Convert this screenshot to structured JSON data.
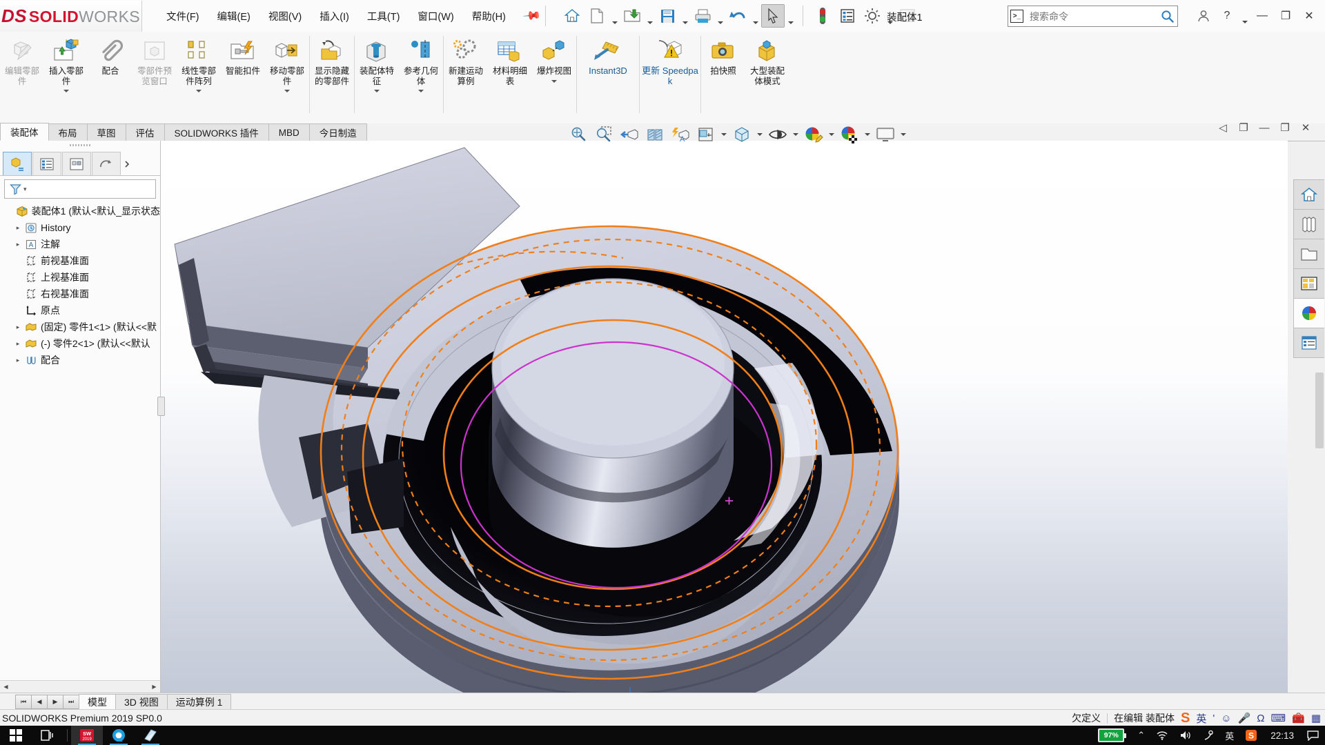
{
  "app": {
    "brand_ds": "DS",
    "brand_solid": "SOLID",
    "brand_works": "WORKS",
    "document_title": "装配体1",
    "version_text": "SOLIDWORKS Premium 2019 SP0.0"
  },
  "menu": {
    "items": [
      {
        "label": "文件(F)",
        "name": "menu-file"
      },
      {
        "label": "编辑(E)",
        "name": "menu-edit"
      },
      {
        "label": "视图(V)",
        "name": "menu-view"
      },
      {
        "label": "插入(I)",
        "name": "menu-insert"
      },
      {
        "label": "工具(T)",
        "name": "menu-tools"
      },
      {
        "label": "窗口(W)",
        "name": "menu-window"
      },
      {
        "label": "帮助(H)",
        "name": "menu-help"
      }
    ]
  },
  "quick_access": {
    "icons": [
      "home-icon",
      "new-document-icon",
      "open-folder-icon",
      "save-icon",
      "print-icon",
      "undo-icon",
      "select-cursor-icon",
      "rebuild-traffic-light-icon",
      "options-list-icon",
      "gear-settings-icon",
      "image-icon"
    ]
  },
  "search": {
    "placeholder": "搜索命令",
    "value": "",
    "icon": "command-search-icon"
  },
  "window_buttons": {
    "user": "user-account-icon",
    "help": "help-icon",
    "minimize": "—",
    "maximize": "❐",
    "close": "✕"
  },
  "ribbon": {
    "groups": [
      {
        "items": [
          {
            "label": "编辑零部件",
            "icon": "edit-component-icon",
            "disabled": true,
            "name": "ribbon-edit-component"
          },
          {
            "label": "插入零部件",
            "icon": "insert-component-icon",
            "disabled": false,
            "caret": true,
            "name": "ribbon-insert-component"
          },
          {
            "label": "配合",
            "icon": "mate-paperclip-icon",
            "disabled": false,
            "name": "ribbon-mate"
          },
          {
            "label": "零部件预览窗口",
            "icon": "component-preview-icon",
            "disabled": true,
            "name": "ribbon-component-preview"
          },
          {
            "label": "线性零部件阵列",
            "icon": "linear-pattern-icon",
            "disabled": false,
            "caret": true,
            "name": "ribbon-linear-pattern"
          },
          {
            "label": "智能扣件",
            "icon": "smart-fasteners-icon",
            "disabled": false,
            "name": "ribbon-smart-fasteners"
          },
          {
            "label": "移动零部件",
            "icon": "move-component-icon",
            "disabled": false,
            "caret": true,
            "name": "ribbon-move-component"
          }
        ]
      },
      {
        "items": [
          {
            "label": "显示隐藏的零部件",
            "icon": "show-hidden-components-icon",
            "disabled": false,
            "name": "ribbon-show-hidden"
          }
        ]
      },
      {
        "items": [
          {
            "label": "装配体特征",
            "icon": "assembly-feature-icon",
            "disabled": false,
            "caret": true,
            "name": "ribbon-assembly-feature"
          },
          {
            "label": "参考几何体",
            "icon": "reference-geometry-icon",
            "disabled": false,
            "caret": true,
            "name": "ribbon-reference-geometry"
          }
        ]
      },
      {
        "items": [
          {
            "label": "新建运动算例",
            "icon": "new-motion-study-icon",
            "disabled": false,
            "name": "ribbon-new-motion-study"
          },
          {
            "label": "材料明细表",
            "icon": "bill-of-materials-icon",
            "disabled": false,
            "name": "ribbon-bom"
          },
          {
            "label": "爆炸视图",
            "icon": "exploded-view-icon",
            "disabled": false,
            "caret": true,
            "name": "ribbon-exploded-view"
          }
        ]
      },
      {
        "items": [
          {
            "label": "Instant3D",
            "icon": "instant3d-ruler-icon",
            "disabled": false,
            "blue": true,
            "name": "ribbon-instant3d"
          }
        ]
      },
      {
        "items": [
          {
            "label": "更新 Speedpak",
            "icon": "update-speedpak-icon",
            "disabled": false,
            "blue": true,
            "name": "ribbon-update-speedpak"
          }
        ]
      },
      {
        "items": [
          {
            "label": "拍快照",
            "icon": "take-snapshot-camera-icon",
            "disabled": false,
            "name": "ribbon-take-snapshot"
          },
          {
            "label": "大型装配体模式",
            "icon": "large-assembly-mode-icon",
            "disabled": false,
            "name": "ribbon-large-assembly-mode"
          }
        ]
      }
    ]
  },
  "command_tabs": {
    "selected": "装配体",
    "items": [
      "装配体",
      "布局",
      "草图",
      "评估",
      "SOLIDWORKS 插件",
      "MBD",
      "今日制造"
    ]
  },
  "left_panel": {
    "tabs": [
      {
        "name": "feature-manager-tab",
        "icon": "feature-tree-icon",
        "selected": true
      },
      {
        "name": "property-manager-tab",
        "icon": "property-list-icon",
        "selected": false
      },
      {
        "name": "configuration-manager-tab",
        "icon": "configuration-icon",
        "selected": false
      },
      {
        "name": "dimxpert-manager-tab",
        "icon": "dimxpert-icon",
        "selected": false
      }
    ],
    "filter_placeholder": "",
    "filter_icon": "filter-funnel-icon",
    "tree": [
      {
        "label": "装配体1  (默认<默认_显示状态",
        "icon": "assembly-icon",
        "indent": 0,
        "expandable": false,
        "name": "tree-root-assembly"
      },
      {
        "label": "History",
        "icon": "history-icon",
        "indent": 1,
        "expandable": true,
        "name": "tree-history"
      },
      {
        "label": "注解",
        "icon": "annotations-icon",
        "indent": 1,
        "expandable": true,
        "name": "tree-annotations"
      },
      {
        "label": "前视基准面",
        "icon": "plane-icon",
        "indent": 1,
        "expandable": false,
        "name": "tree-front-plane"
      },
      {
        "label": "上视基准面",
        "icon": "plane-icon",
        "indent": 1,
        "expandable": false,
        "name": "tree-top-plane"
      },
      {
        "label": "右视基准面",
        "icon": "plane-icon",
        "indent": 1,
        "expandable": false,
        "name": "tree-right-plane"
      },
      {
        "label": "原点",
        "icon": "origin-icon",
        "indent": 1,
        "expandable": false,
        "name": "tree-origin"
      },
      {
        "label": "(固定) 零件1<1>  (默认<<默",
        "icon": "part-icon",
        "indent": 1,
        "expandable": true,
        "name": "tree-part1"
      },
      {
        "label": "(-) 零件2<1>  (默认<<默认",
        "icon": "part-icon",
        "indent": 1,
        "expandable": true,
        "name": "tree-part2"
      },
      {
        "label": "配合",
        "icon": "mates-icon",
        "indent": 1,
        "expandable": true,
        "name": "tree-mates"
      }
    ]
  },
  "view_toolbar": {
    "items": [
      {
        "icon": "zoom-to-fit-icon",
        "name": "view-zoom-to-fit"
      },
      {
        "icon": "zoom-to-area-icon",
        "name": "view-zoom-to-area"
      },
      {
        "icon": "previous-view-icon",
        "name": "view-previous"
      },
      {
        "icon": "section-view-icon",
        "name": "view-section"
      },
      {
        "icon": "view-orientation-flash-icon",
        "name": "view-orientation-flash"
      },
      {
        "icon": "view-orientation-cube-icon",
        "name": "view-orientation",
        "caret": true
      },
      {
        "icon": "display-style-icon",
        "name": "view-display-style",
        "caret": true
      },
      {
        "icon": "hide-show-items-icon",
        "name": "view-hide-show-items",
        "caret": true
      },
      {
        "icon": "edit-appearance-icon",
        "name": "view-edit-appearance",
        "caret": true
      },
      {
        "icon": "apply-scene-icon",
        "name": "view-apply-scene",
        "caret": true
      },
      {
        "icon": "view-settings-monitor-icon",
        "name": "view-settings",
        "caret": true
      }
    ]
  },
  "window_controls_doc": {
    "restore": "◁",
    "tile": "❐",
    "minimize": "—",
    "maximize": "❐",
    "close": "✕"
  },
  "task_pane": {
    "items": [
      {
        "icon": "solidworks-resources-home-icon",
        "name": "task-pane-resources",
        "selected": false
      },
      {
        "icon": "design-library-icon",
        "name": "task-pane-design-library",
        "selected": false
      },
      {
        "icon": "file-explorer-icon",
        "name": "task-pane-file-explorer",
        "selected": false
      },
      {
        "icon": "view-palette-icon",
        "name": "task-pane-view-palette",
        "selected": false
      },
      {
        "icon": "appearances-scenes-icon",
        "name": "task-pane-appearances",
        "selected": true
      },
      {
        "icon": "custom-properties-icon",
        "name": "task-pane-custom-properties",
        "selected": false
      }
    ]
  },
  "bottom_tabs": {
    "nav": [
      "⏮",
      "◀",
      "▶",
      "⏭"
    ],
    "selected": "模型",
    "items": [
      "模型",
      "3D 视图",
      "运动算例 1"
    ]
  },
  "status_bar": {
    "left_text": "SOLIDWORKS Premium 2019 SP0.0",
    "under_defined": "欠定义",
    "editing": "在编辑 装配体",
    "ime_mode": "英",
    "ime_icons": [
      "sogou-s-icon",
      "comma-icon",
      "smiley-icon",
      "microphone-icon",
      "omega-icon",
      "keyboard-icon",
      "toolbox-icon",
      "menu-grid-icon"
    ]
  },
  "taskbar": {
    "start_icon": "windows-start-icon",
    "task_view_icon": "task-view-icon",
    "apps": [
      {
        "icon": "solidworks-2019-icon",
        "name": "taskbar-solidworks",
        "running": true,
        "active": true
      },
      {
        "icon": "browser-o-icon",
        "name": "taskbar-browser",
        "running": true,
        "active": false
      },
      {
        "icon": "store-icon",
        "name": "taskbar-store",
        "running": true,
        "active": false
      }
    ],
    "tray": {
      "battery_percent": "97%",
      "icons": [
        "chevron-up-icon",
        "wifi-icon",
        "volume-icon",
        "pen-icon"
      ],
      "ime": "英",
      "sogou": "sogou-icon",
      "clock": "22:13",
      "notifications": "notification-icon"
    }
  }
}
